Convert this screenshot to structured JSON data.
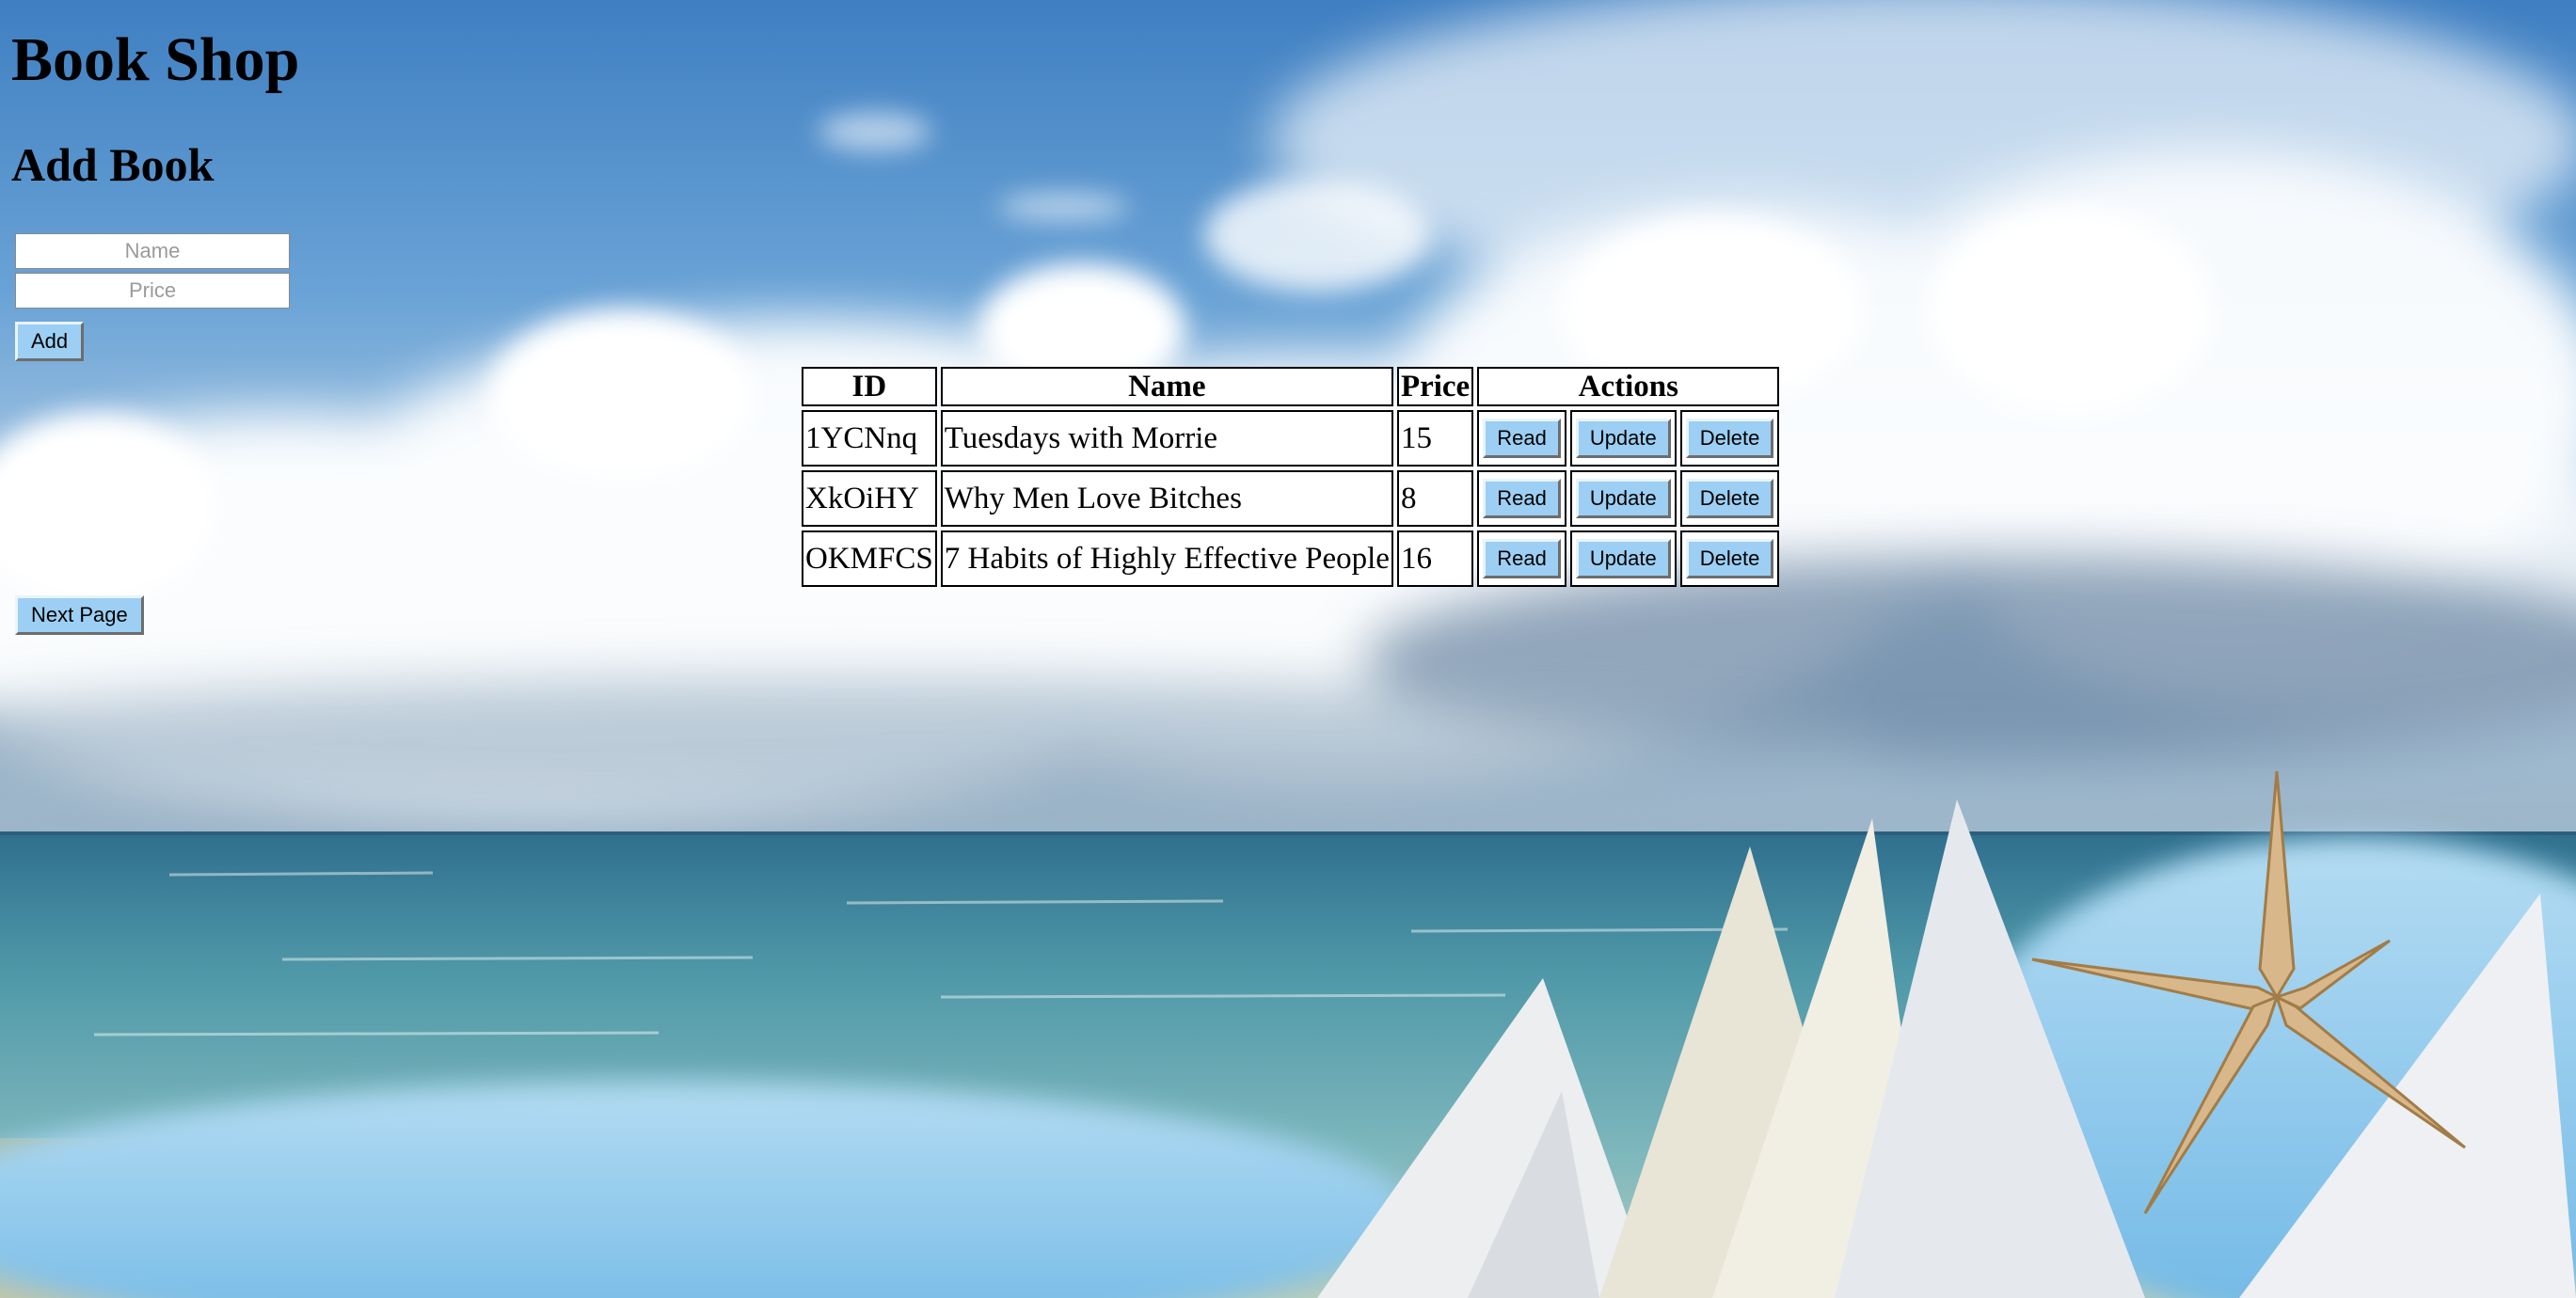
{
  "page": {
    "title": "Book Shop",
    "add_section_title": "Add Book"
  },
  "add_form": {
    "name_placeholder": "Name",
    "price_placeholder": "Price",
    "add_label": "Add"
  },
  "table": {
    "headers": [
      "ID",
      "Name",
      "Price",
      "Actions"
    ],
    "rows": [
      {
        "id": "1YCNnq",
        "name": "Tuesdays with Morrie",
        "price": "15"
      },
      {
        "id": "XkOiHY",
        "name": "Why Men Love Bitches",
        "price": "8"
      },
      {
        "id": "OKMFCS",
        "name": "7 Habits of Highly Effective People",
        "price": "16"
      }
    ],
    "actions": {
      "read_label": "Read",
      "update_label": "Update",
      "delete_label": "Delete"
    }
  },
  "pagination": {
    "next_label": "Next Page"
  },
  "colors": {
    "button_bg": "#9ccff3",
    "sky": "#4a86c6",
    "sea": "#4f98a8"
  }
}
